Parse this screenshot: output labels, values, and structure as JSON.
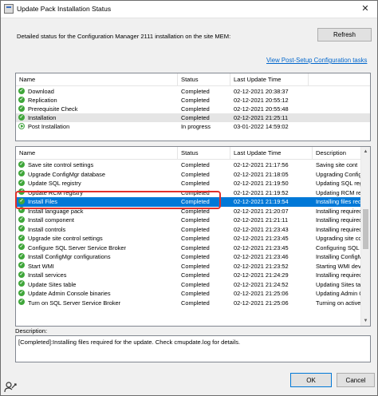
{
  "window": {
    "title": "Update Pack Installation Status",
    "close_glyph": "✕",
    "detail_text": "Detailed status for the Configuration Manager 2111 installation on the site MEM:",
    "refresh_label": "Refresh",
    "link_text": "View Post-Setup Configuration tasks"
  },
  "top_list": {
    "columns": [
      "Name",
      "Status",
      "Last Update Time"
    ],
    "rows": [
      {
        "name": "Download",
        "status": "Completed",
        "time": "02-12-2021 20:38:37",
        "icon": "check-icon"
      },
      {
        "name": "Replication",
        "status": "Completed",
        "time": "02-12-2021 20:55:12",
        "icon": "check-icon"
      },
      {
        "name": "Prerequisite Check",
        "status": "Completed",
        "time": "02-12-2021 20:55:48",
        "icon": "check-icon"
      },
      {
        "name": "Installation",
        "status": "Completed",
        "time": "02-12-2021 21:25:11",
        "icon": "check-icon"
      },
      {
        "name": "Post Installation",
        "status": "In progress",
        "time": "03-01-2022 14:59:02",
        "icon": "in-progress-icon"
      }
    ]
  },
  "detail_list": {
    "columns": [
      "Name",
      "Status",
      "Last Update Time",
      "Description"
    ],
    "rows": [
      {
        "name": "Save site control settings",
        "status": "Completed",
        "time": "02-12-2021 21:17:56",
        "desc": "Saving site cont"
      },
      {
        "name": "Upgrade ConfigMgr database",
        "status": "Completed",
        "time": "02-12-2021 21:18:05",
        "desc": "Upgrading Config"
      },
      {
        "name": "Update SQL registry",
        "status": "Completed",
        "time": "02-12-2021 21:19:50",
        "desc": "Updating SQL reg"
      },
      {
        "name": "Update RCM registry",
        "status": "Completed",
        "time": "02-12-2021 21:19:52",
        "desc": "Updating RCM reg"
      },
      {
        "name": "Install Files",
        "status": "Completed",
        "time": "02-12-2021 21:19:54",
        "desc": "Installing files requ"
      },
      {
        "name": "Install language pack",
        "status": "Completed",
        "time": "02-12-2021 21:20:07",
        "desc": "Installing required"
      },
      {
        "name": "Install component",
        "status": "Completed",
        "time": "02-12-2021 21:21:11",
        "desc": "Installing required"
      },
      {
        "name": "Install controls",
        "status": "Completed",
        "time": "02-12-2021 21:23:43",
        "desc": "Installing required"
      },
      {
        "name": "Upgrade site control settings",
        "status": "Completed",
        "time": "02-12-2021 21:23:45",
        "desc": "Upgrading site co"
      },
      {
        "name": "Configure SQL Server Service Broker",
        "status": "Completed",
        "time": "02-12-2021 21:23:45",
        "desc": "Configuring SQL"
      },
      {
        "name": "Install ConfigMgr configurations",
        "status": "Completed",
        "time": "02-12-2021 21:23:46",
        "desc": "Installing ConfigM"
      },
      {
        "name": "Start WMI",
        "status": "Completed",
        "time": "02-12-2021 21:23:52",
        "desc": "Starting WMI dev"
      },
      {
        "name": "Install services",
        "status": "Completed",
        "time": "02-12-2021 21:24:29",
        "desc": "Installing required"
      },
      {
        "name": "Update Sites table",
        "status": "Completed",
        "time": "02-12-2021 21:24:52",
        "desc": "Updating Sites tab"
      },
      {
        "name": "Update Admin Console binaries",
        "status": "Completed",
        "time": "02-12-2021 21:25:06",
        "desc": "Updating Admin C"
      },
      {
        "name": "Turn on SQL Server Service Broker",
        "status": "Completed",
        "time": "02-12-2021 21:25:06",
        "desc": "Turning on active"
      }
    ],
    "selected_index": 4
  },
  "description": {
    "label": "Description:",
    "text": "[Completed]:Installing files required for the update. Check cmupdate.log for details."
  },
  "buttons": {
    "ok": "OK",
    "cancel": "Cancel"
  },
  "colors": {
    "selection": "#0078d7",
    "success": "#3fa63a",
    "highlight": "#e0302a",
    "link": "#0066cc"
  }
}
